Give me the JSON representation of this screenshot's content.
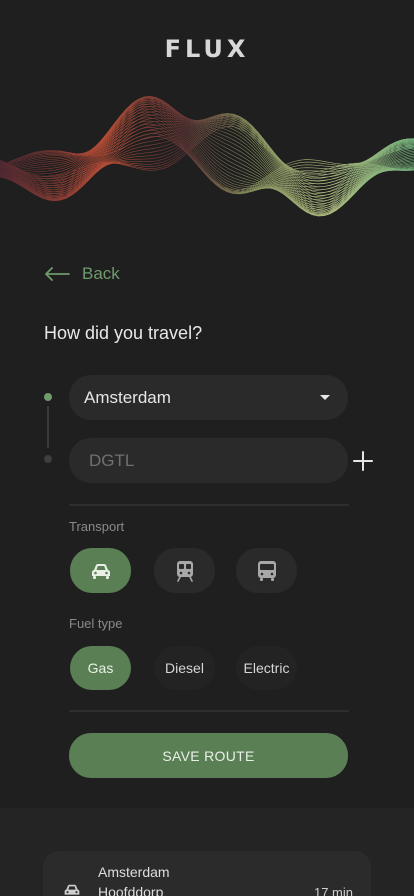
{
  "app": {
    "logo": "FLUX"
  },
  "nav": {
    "back_label": "Back"
  },
  "form": {
    "question": "How did you travel?",
    "origin": {
      "value": "Amsterdam"
    },
    "destination": {
      "value": "",
      "placeholder": "DGTL"
    },
    "transport": {
      "label": "Transport",
      "options": [
        {
          "name": "car",
          "icon": "car-icon",
          "selected": true
        },
        {
          "name": "train",
          "icon": "train-icon",
          "selected": false
        },
        {
          "name": "bus",
          "icon": "bus-icon",
          "selected": false
        }
      ]
    },
    "fuel": {
      "label": "Fuel type",
      "options": [
        {
          "label": "Gas",
          "selected": true
        },
        {
          "label": "Diesel",
          "selected": false
        },
        {
          "label": "Electric",
          "selected": false
        }
      ]
    },
    "save_label": "SAVE ROUTE"
  },
  "routes": [
    {
      "from": "Amsterdam",
      "to": "Hoofddorp",
      "duration": "17 min",
      "icon": "car-icon"
    }
  ],
  "colors": {
    "accent": "#5b7f55",
    "accent_text": "#6f9a6c",
    "background": "#1f1f1f",
    "field": "#2a2a2a"
  }
}
